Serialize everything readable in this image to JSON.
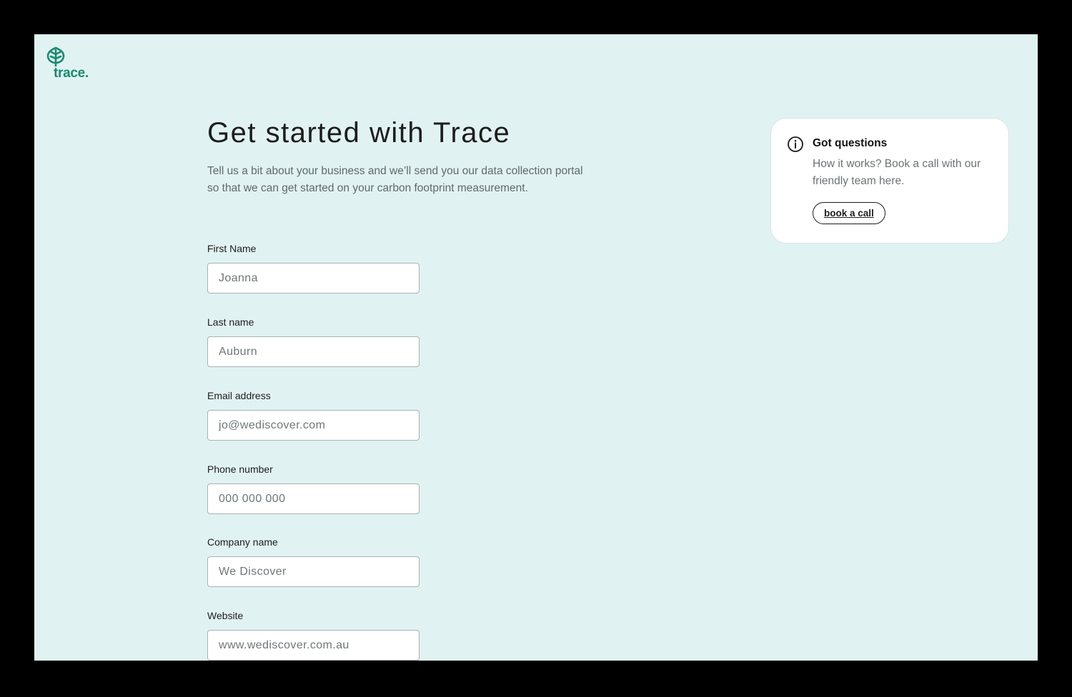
{
  "brand": {
    "name": "trace.",
    "logo_icon": "leaf-icon",
    "color": "#1a8a6e"
  },
  "header": {
    "title": "Get started with Trace",
    "subtitle": "Tell us a bit about your business and we’ll send you our data collection portal so that we can get started on your carbon footprint measurement."
  },
  "form": {
    "fields": [
      {
        "label": "First Name",
        "placeholder": "Joanna"
      },
      {
        "label": "Last name",
        "placeholder": "Auburn"
      },
      {
        "label": "Email address",
        "placeholder": "jo@wediscover.com"
      },
      {
        "label": "Phone number",
        "placeholder": "000 000 000"
      },
      {
        "label": "Company name",
        "placeholder": "We Discover"
      },
      {
        "label": "Website",
        "placeholder": "www.wediscover.com.au"
      }
    ]
  },
  "help_card": {
    "icon": "info-icon",
    "title": "Got questions",
    "text": "How it works? Book a call with our friendly team here.",
    "button_label": "book a call"
  },
  "colors": {
    "page_background": "#e1f2f3",
    "frame": "#000000",
    "accent": "#1a8a6e"
  }
}
